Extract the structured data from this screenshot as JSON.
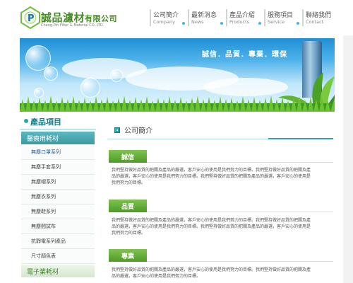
{
  "brand": {
    "mark_letter": "P",
    "name": "誠品濾材",
    "company_suffix": "有限公司",
    "english": "Cheng-Pin Filter & Material CO.,LTD."
  },
  "nav": [
    {
      "zh": "公司簡介",
      "en": "Company"
    },
    {
      "zh": "最新消息",
      "en": "News"
    },
    {
      "zh": "產品介紹",
      "en": "Products"
    },
    {
      "zh": "服務項目",
      "en": "Service"
    },
    {
      "zh": "聯絡我們",
      "en": "Contact"
    }
  ],
  "banner": {
    "slogan": "誠信．品質．專業．環保"
  },
  "sidebar": {
    "title": "產品項目",
    "category_active": "醫療用耗材",
    "items": [
      "無塵口罩系列",
      "無塵手套系列",
      "無塵帽系列",
      "無塵衣系列",
      "無塵鞋系列",
      "無塵間試布",
      "抗靜電系列產品",
      "尺寸顏色表"
    ],
    "category_next": "電子業耗材"
  },
  "main": {
    "page_title": "公司簡介",
    "sections": [
      {
        "title": "誠信",
        "text": "我們堅持做好品質的把關及產品的嚴選，客戶安心的使用是我們努力的目標。我們堅持做好品質的把關及產品的嚴選，客戶安心的使用是我們努力的目標。我們堅持做好品質的把關及產品的嚴選，客戶安心的使用是我們努力的目標。"
      },
      {
        "title": "品質",
        "text": "我們堅持做好品質的把關及產品的嚴選，客戶安心的使用是我們努力的目標。我們堅持做好品質的把關及產品的嚴選，客戶安心的使用是我們努力的目標。我們堅持做好品質的把關及產品的嚴選，客戶安心的使用是我們努力的目標。"
      },
      {
        "title": "專業",
        "text": "我們堅持做好品質的把關及產品的嚴選，客戶安心的使用是我們努力的目標。我們堅持做好品質的把關及產品的嚴選，客戶安心的使用是我們努力的目標。"
      }
    ]
  },
  "colors": {
    "accent_teal": "#2aa5b0",
    "accent_green": "#4f9a26",
    "brand_green": "#4a8a2a"
  }
}
